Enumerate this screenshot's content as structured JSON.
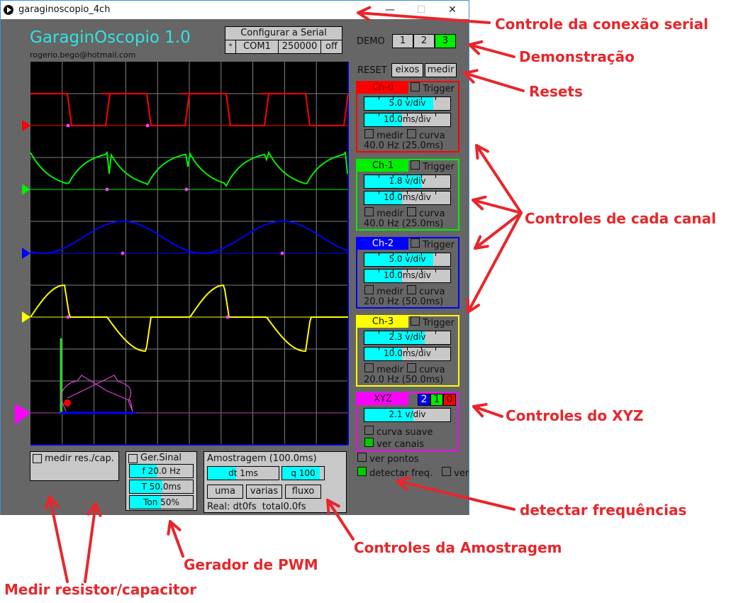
{
  "window": {
    "title": "garaginoscopio_4ch",
    "minimize": "—",
    "maximize": "☐",
    "close": "✕"
  },
  "app": {
    "title": "GaraginOscopio 1.0",
    "email": "rogerio.bego@hotmail.com"
  },
  "serial": {
    "header": "Configurar a Serial",
    "star": "*",
    "port": "COM1",
    "baud": "250000",
    "state": "off"
  },
  "demo": {
    "label": "DEMO",
    "buttons": [
      "1",
      "2",
      "3"
    ],
    "active": "3"
  },
  "reset": {
    "label": "RESET",
    "buttons": [
      "eixos",
      "medir"
    ]
  },
  "channels": [
    {
      "name": "Ch-0",
      "color": "#ff0000",
      "text_color": "#8b0000",
      "trigger": "Trigger",
      "vdiv": "5.0 v/div",
      "vdiv_level": 0.8,
      "tdiv": "10.0ms/div",
      "tdiv_level": 0.44,
      "medir": "medir",
      "curva": "curva",
      "freq": "40.0 Hz (25.0ms)"
    },
    {
      "name": "Ch-1",
      "color": "#00ee00",
      "text_color": "#111111",
      "trigger": "Trigger",
      "vdiv": "1.8 v/div",
      "vdiv_level": 0.67,
      "tdiv": "10.0ms/div",
      "tdiv_level": 0.44,
      "medir": "medir",
      "curva": "curva",
      "freq": "40.0 Hz (25.0ms)"
    },
    {
      "name": "Ch-2",
      "color": "#0000ff",
      "text_color": "#ffffff",
      "trigger": "Trigger",
      "vdiv": "5.0 v/div",
      "vdiv_level": 0.8,
      "tdiv": "10.0ms/div",
      "tdiv_level": 0.44,
      "medir": "medir",
      "curva": "curva",
      "freq": "20.0 Hz (50.0ms)"
    },
    {
      "name": "Ch-3",
      "color": "#ffff00",
      "text_color": "#111111",
      "trigger": "Trigger",
      "vdiv": "2.3 v/div",
      "vdiv_level": 0.7,
      "tdiv": "10.0ms/div",
      "tdiv_level": 0.44,
      "medir": "medir",
      "curva": "curva",
      "freq": "20.0 Hz (50.0ms)"
    }
  ],
  "xyz": {
    "name": "XYZ",
    "color": "#ff00ff",
    "sel": [
      "2",
      "1",
      "0"
    ],
    "vdiv": "2.1 v/div",
    "vdiv_level": 0.57,
    "curva_suave": "curva suave",
    "ver_canais": "ver canais"
  },
  "options": {
    "ver_pontos": "ver pontos",
    "detectar_freq": "detectar freq.",
    "ver": "ver"
  },
  "res_cap": {
    "label": "medir res./cap."
  },
  "gen": {
    "label": "Ger.Sinal",
    "f": "f 20.0 Hz",
    "f_level": 0.43,
    "T": "T 50.0ms",
    "T_level": 0.52,
    "ton": "Ton 50%",
    "ton_level": 0.49
  },
  "sampling": {
    "title": "Amostragem (100.0ms)",
    "dt": "dt 1ms",
    "dt_level": 0.4,
    "q": "q 100",
    "q_level": 0.9,
    "buttons": [
      "uma",
      "varias",
      "fluxo"
    ],
    "real": "Real: dt0fs  total0.0fs"
  },
  "annotations": [
    "Controle da conexão serial",
    "Demonstração",
    "Resets",
    "Controles de cada canal",
    "Controles do XYZ",
    "detectar frequências",
    "Controles da Amostragem",
    "Gerador de PWM",
    "Medir resistor/capacitor"
  ]
}
